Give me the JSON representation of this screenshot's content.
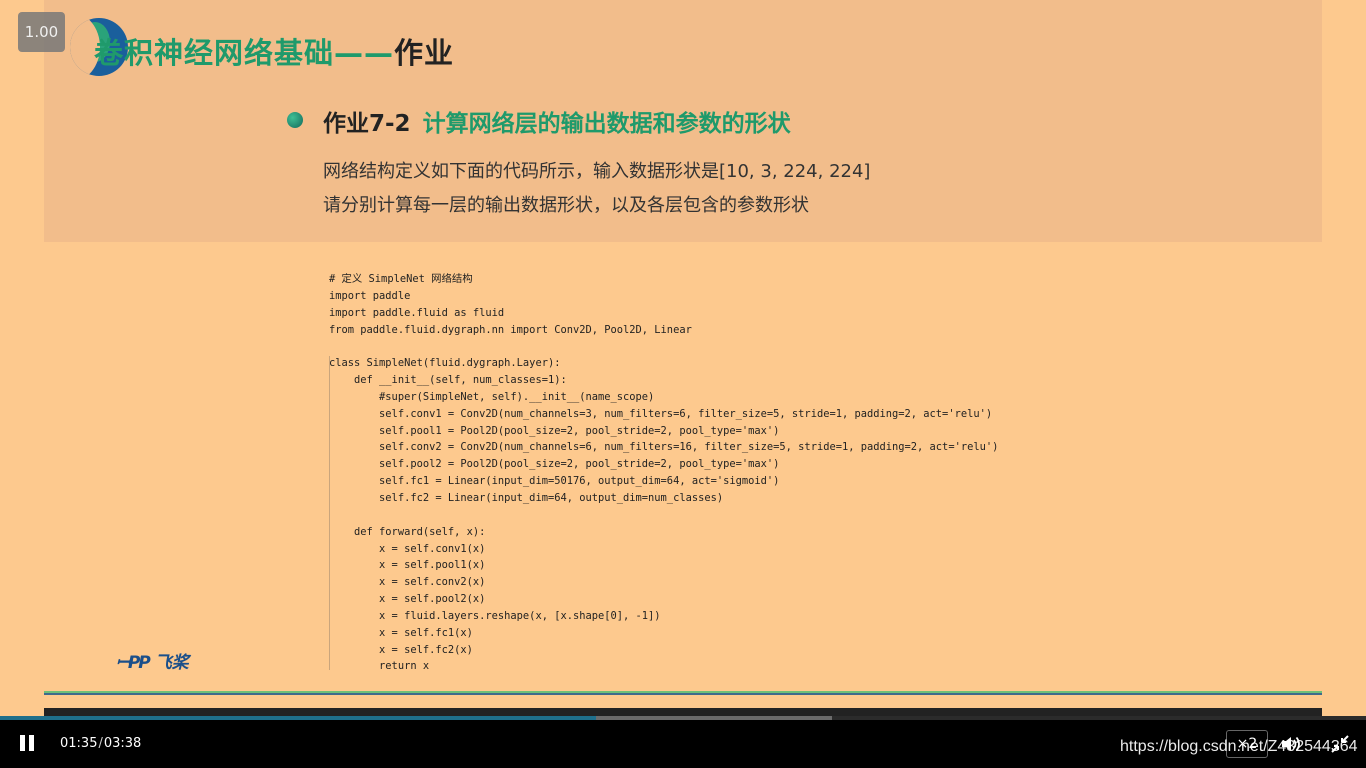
{
  "overlay": {
    "speed_badge": "1.00"
  },
  "slide": {
    "title_green": "卷积神经网络基础——",
    "title_dark": "作业",
    "task_number": "作业7-2",
    "task_title": "计算网络层的输出数据和参数的形状",
    "description_line1": "网络结构定义如下面的代码所示，输入数据形状是[10, 3, 224, 224]",
    "description_line2": "请分别计算每一层的输出数据形状，以及各层包含的参数形状",
    "code_lines": [
      "# 定义 SimpleNet 网络结构",
      "import paddle",
      "import paddle.fluid as fluid",
      "from paddle.fluid.dygraph.nn import Conv2D, Pool2D, Linear",
      "",
      "class SimpleNet(fluid.dygraph.Layer):",
      "    def __init__(self, num_classes=1):",
      "        #super(SimpleNet, self).__init__(name_scope)",
      "        self.conv1 = Conv2D(num_channels=3, num_filters=6, filter_size=5, stride=1, padding=2, act='relu')",
      "        self.pool1 = Pool2D(pool_size=2, pool_stride=2, pool_type='max')",
      "        self.conv2 = Conv2D(num_channels=6, num_filters=16, filter_size=5, stride=1, padding=2, act='relu')",
      "        self.pool2 = Pool2D(pool_size=2, pool_stride=2, pool_type='max')",
      "        self.fc1 = Linear(input_dim=50176, output_dim=64, act='sigmoid')",
      "        self.fc2 = Linear(input_dim=64, output_dim=num_classes)",
      "",
      "    def forward(self, x):",
      "        x = self.conv1(x)",
      "        x = self.pool1(x)",
      "        x = self.conv2(x)",
      "        x = self.pool2(x)",
      "        x = fluid.layers.reshape(x, [x.shape[0], -1])",
      "        x = self.fc1(x)",
      "        x = self.fc2(x)",
      "        return x"
    ],
    "brand_logo_text": "飞桨"
  },
  "player": {
    "current_time": "01:35",
    "separator": "/",
    "total_time": "03:38",
    "progress_played": 0.436,
    "progress_buffered": 0.609,
    "speed_label": "×2",
    "volume_icon": "volume-icon",
    "fullscreen_icon": "fullscreen-exit-icon",
    "accent_color": "#1f6f8b"
  },
  "watermark": "https://blog.csdn.net/Z432544364"
}
